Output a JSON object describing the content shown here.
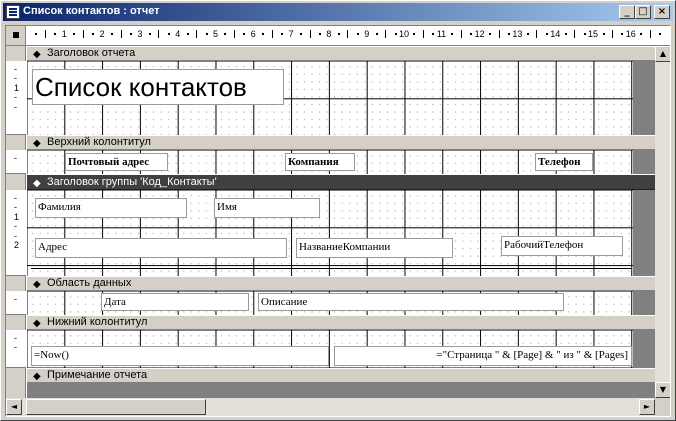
{
  "window": {
    "title": "Список контактов : отчет",
    "minimize_glyph": "_",
    "maximize_glyph": "□",
    "close_glyph": "×"
  },
  "ruler": {
    "numbers": [
      "1",
      "2",
      "3",
      "4",
      "5",
      "6",
      "7",
      "8",
      "9",
      "10",
      "11",
      "12",
      "13",
      "14",
      "15",
      "16"
    ],
    "vertical": {
      "report_header": [
        "-",
        "-",
        "1",
        "-",
        "-"
      ],
      "page_header": [
        "-"
      ],
      "group_header": [
        "-",
        "-",
        "1",
        "-",
        "-",
        "2"
      ],
      "detail": [
        "-"
      ],
      "page_footer": [
        "-",
        "-"
      ]
    }
  },
  "sections": {
    "report_header": "Заголовок отчета",
    "page_header": "Верхний колонтитул",
    "group_header": "Заголовок группы 'Код_Контакты'",
    "detail": "Область данных",
    "page_footer": "Нижний колонтитул",
    "report_footer": "Примечание отчета"
  },
  "controls": {
    "report_title": "Список контактов",
    "postal_address_label": "Почтовый адрес",
    "company_label": "Компания",
    "phone_label": "Телефон",
    "last_name": "Фамилия",
    "first_name": "Имя",
    "address": "Адрес",
    "company_name": "НазваниеКомпании",
    "work_phone": "РабочийТелефон",
    "date": "Дата",
    "description": "Описание",
    "now": "=Now()",
    "page_expr": "=\"Страница \" & [Page] & \" из \" & [Pages]"
  },
  "scroll": {
    "up": "▲",
    "down": "▼",
    "left": "◄",
    "right": "►"
  }
}
